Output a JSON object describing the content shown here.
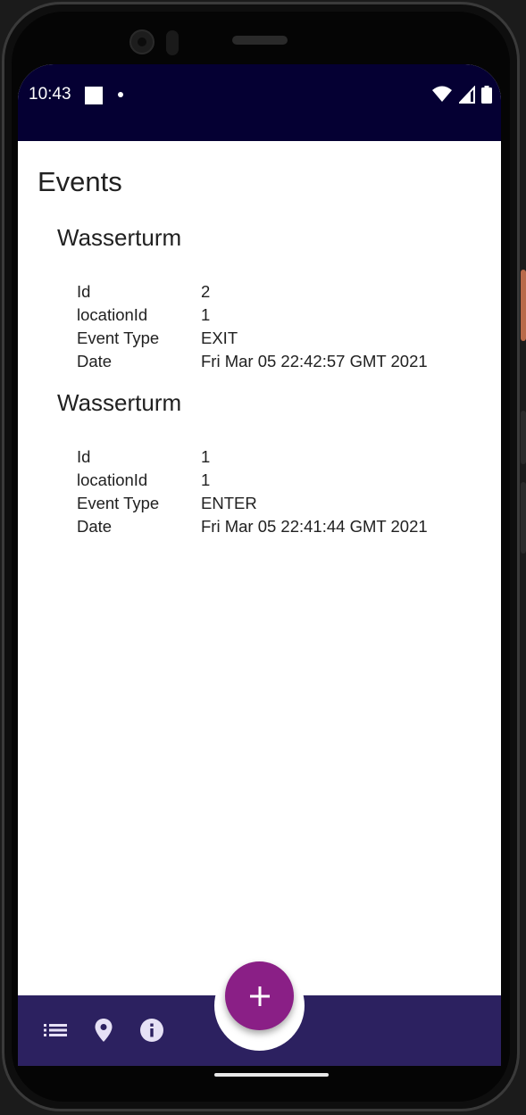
{
  "status_bar": {
    "time": "10:43",
    "icons": [
      "wifi-icon",
      "signal-icon",
      "battery-icon"
    ]
  },
  "page": {
    "title": "Events"
  },
  "events": [
    {
      "title": "Wasserturm",
      "rows": [
        {
          "key": "Id",
          "value": "2"
        },
        {
          "key": "locationId",
          "value": "1"
        },
        {
          "key": "Event Type",
          "value": "EXIT"
        },
        {
          "key": "Date",
          "value": "Fri Mar 05 22:42:57 GMT 2021"
        }
      ]
    },
    {
      "title": "Wasserturm",
      "rows": [
        {
          "key": "Id",
          "value": "1"
        },
        {
          "key": "locationId",
          "value": "1"
        },
        {
          "key": "Event Type",
          "value": "ENTER"
        },
        {
          "key": "Date",
          "value": "Fri Mar 05 22:41:44 GMT 2021"
        }
      ]
    }
  ],
  "bottom_nav": {
    "items": [
      "list-icon",
      "location-pin-icon",
      "info-icon"
    ],
    "fab_icon": "plus-icon"
  },
  "colors": {
    "status_bar": "#050033",
    "bottom_bar": "#2c2160",
    "fab": "#8a1f86",
    "text": "#212121"
  }
}
